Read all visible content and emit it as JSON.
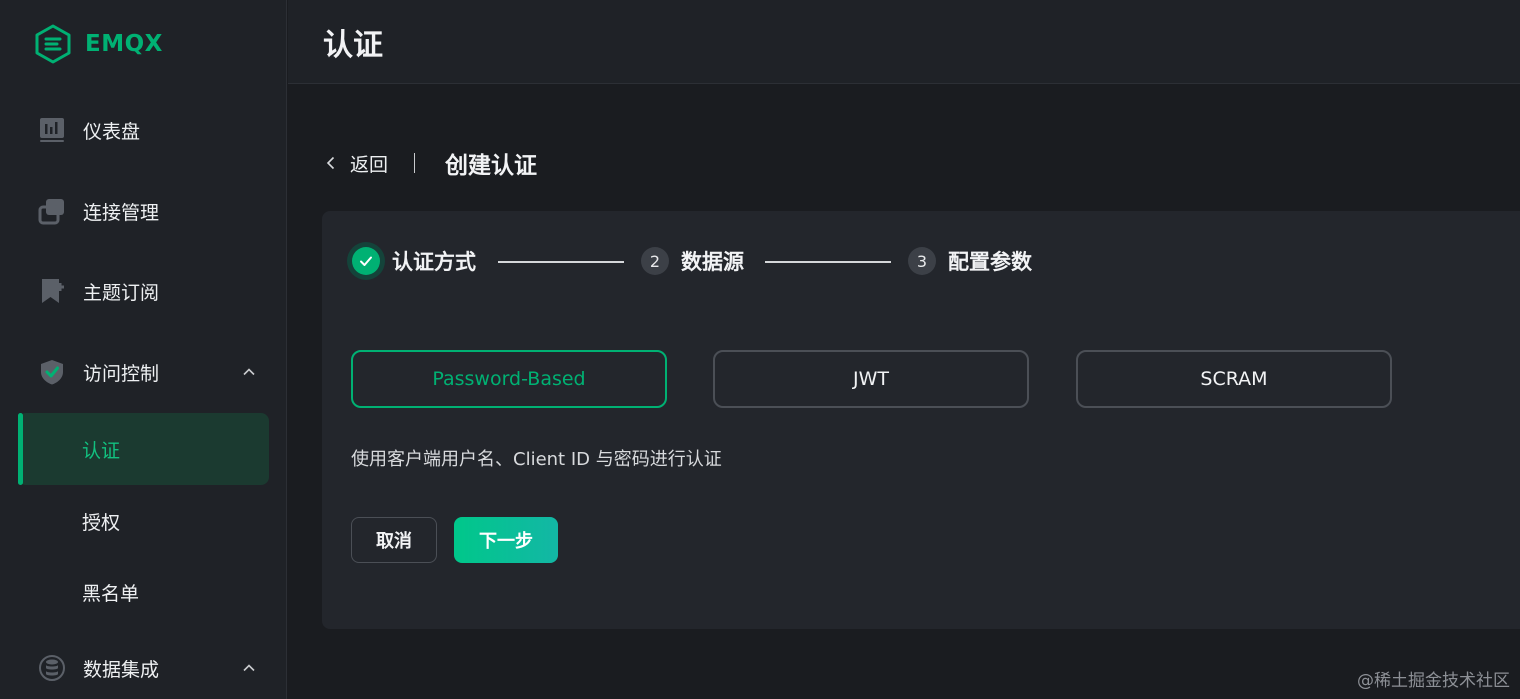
{
  "brand": {
    "name": "EMQX",
    "color": "#00b173"
  },
  "sidebar": {
    "items": [
      {
        "label": "仪表盘",
        "icon": "dashboard-icon"
      },
      {
        "label": "连接管理",
        "icon": "connections-icon"
      },
      {
        "label": "主题订阅",
        "icon": "subscriptions-icon"
      },
      {
        "label": "访问控制",
        "icon": "shield-check-icon",
        "expanded": true
      },
      {
        "label": "数据集成",
        "icon": "database-icon",
        "expanded": true
      }
    ],
    "access_control_children": [
      {
        "label": "认证",
        "active": true
      },
      {
        "label": "授权"
      },
      {
        "label": "黑名单"
      }
    ]
  },
  "header": {
    "title": "认证"
  },
  "breadcrumb": {
    "back_label": "返回",
    "title": "创建认证"
  },
  "steps": [
    {
      "number": "1",
      "label": "认证方式",
      "status": "done"
    },
    {
      "number": "2",
      "label": "数据源",
      "status": "pending"
    },
    {
      "number": "3",
      "label": "配置参数",
      "status": "pending"
    }
  ],
  "methods": [
    {
      "label": "Password-Based",
      "selected": true
    },
    {
      "label": "JWT",
      "selected": false
    },
    {
      "label": "SCRAM",
      "selected": false
    }
  ],
  "description": "使用客户端用户名、Client ID 与密码进行认证",
  "actions": {
    "cancel_label": "取消",
    "next_label": "下一步"
  },
  "watermark": "@稀土掘金技术社区"
}
